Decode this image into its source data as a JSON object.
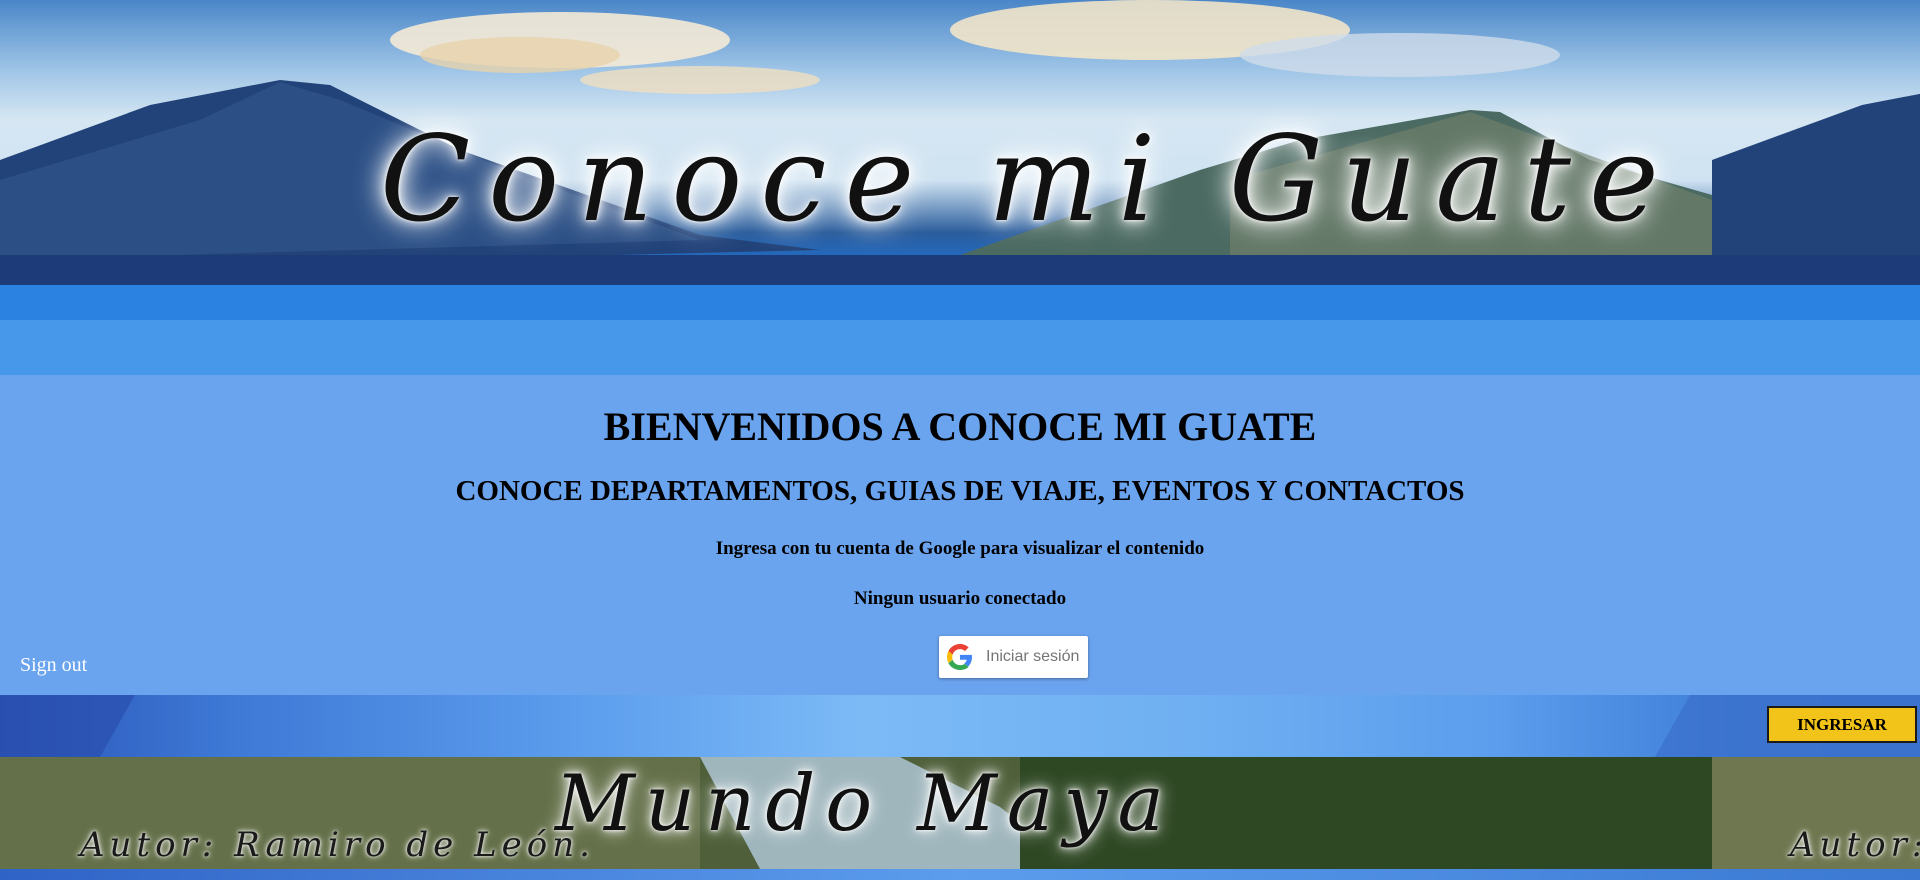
{
  "header": {
    "banner_title": "Conoce mi Guate"
  },
  "main": {
    "welcome_heading": "BIENVENIDOS A CONOCE MI GUATE",
    "subtitle": "CONOCE DEPARTAMENTOS, GUIAS DE VIAJE, EVENTOS Y CONTACTOS",
    "login_prompt": "Ingresa con tu cuenta de Google para visualizar el contenido",
    "user_status": "Ningun usuario conectado",
    "sign_out_label": "Sign out",
    "google_button_label": "Iniciar sesión"
  },
  "actions": {
    "enter_label": "INGRESAR"
  },
  "footer": {
    "banner_title": "Mundo Maya",
    "author": "Autor: Ramiro de León.",
    "author_repeat": "Autor:"
  },
  "colors": {
    "page_background": "#6aa3ee",
    "enter_button": "#f2c318",
    "sign_out_text": "#ffffff"
  },
  "icons": {
    "google_button_icon": "google-g-icon"
  }
}
